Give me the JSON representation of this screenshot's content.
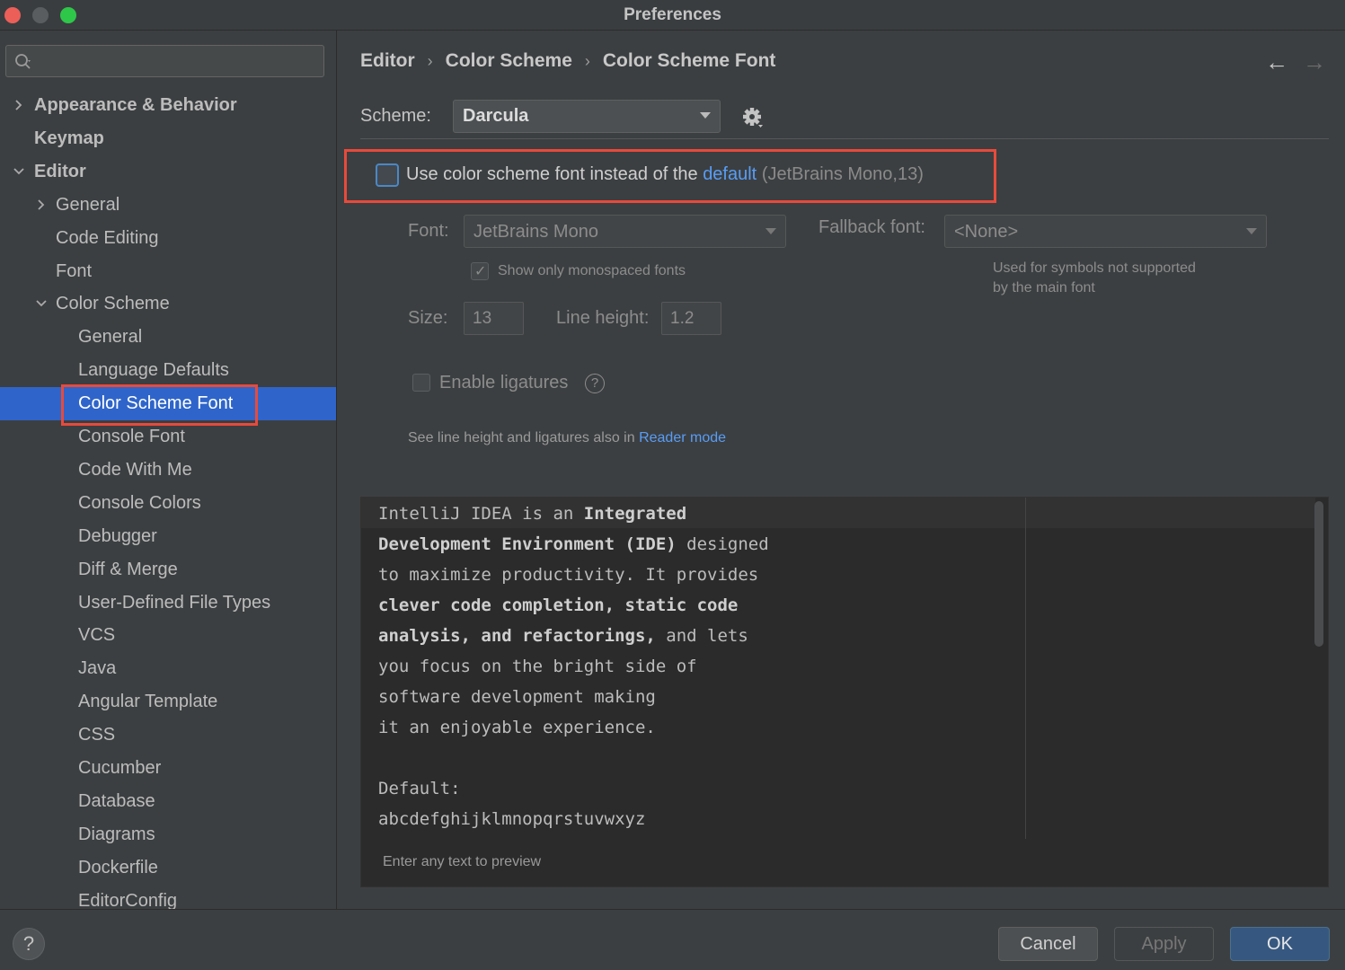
{
  "window": {
    "title": "Preferences"
  },
  "search": {
    "placeholder": "",
    "value": ""
  },
  "sidebar": {
    "items": [
      {
        "label": "Appearance & Behavior",
        "level": 0,
        "chevron": ">",
        "bold": true
      },
      {
        "label": "Keymap",
        "level": 0,
        "chevron": "",
        "bold": true
      },
      {
        "label": "Editor",
        "level": 0,
        "chevron": "v",
        "bold": true
      },
      {
        "label": "General",
        "level": 1,
        "chevron": ">"
      },
      {
        "label": "Code Editing",
        "level": 1,
        "chevron": ""
      },
      {
        "label": "Font",
        "level": 1,
        "chevron": ""
      },
      {
        "label": "Color Scheme",
        "level": 1,
        "chevron": "v"
      },
      {
        "label": "General",
        "level": 2,
        "chevron": ""
      },
      {
        "label": "Language Defaults",
        "level": 2,
        "chevron": ""
      },
      {
        "label": "Color Scheme Font",
        "level": 2,
        "chevron": "",
        "selected": true
      },
      {
        "label": "Console Font",
        "level": 2,
        "chevron": ""
      },
      {
        "label": "Code With Me",
        "level": 2,
        "chevron": ""
      },
      {
        "label": "Console Colors",
        "level": 2,
        "chevron": ""
      },
      {
        "label": "Debugger",
        "level": 2,
        "chevron": ""
      },
      {
        "label": "Diff & Merge",
        "level": 2,
        "chevron": ""
      },
      {
        "label": "User-Defined File Types",
        "level": 2,
        "chevron": ""
      },
      {
        "label": "VCS",
        "level": 2,
        "chevron": ""
      },
      {
        "label": "Java",
        "level": 2,
        "chevron": ""
      },
      {
        "label": "Angular Template",
        "level": 2,
        "chevron": ""
      },
      {
        "label": "CSS",
        "level": 2,
        "chevron": ""
      },
      {
        "label": "Cucumber",
        "level": 2,
        "chevron": ""
      },
      {
        "label": "Database",
        "level": 2,
        "chevron": ""
      },
      {
        "label": "Diagrams",
        "level": 2,
        "chevron": ""
      },
      {
        "label": "Dockerfile",
        "level": 2,
        "chevron": ""
      },
      {
        "label": "EditorConfig",
        "level": 2,
        "chevron": ""
      }
    ]
  },
  "breadcrumb": {
    "items": [
      "Editor",
      "Color Scheme",
      "Color Scheme Font"
    ],
    "separator": "›",
    "back": "←",
    "forward": "→"
  },
  "scheme": {
    "label": "Scheme:",
    "value": "Darcula"
  },
  "use_font": {
    "checked": false,
    "text": "Use color scheme font instead of the",
    "link": "default",
    "hint": "(JetBrains Mono,13)"
  },
  "font": {
    "label": "Font:",
    "value": "JetBrains Mono"
  },
  "fallback": {
    "label": "Fallback font:",
    "value": "<None>",
    "hint_line1": "Used for symbols not supported",
    "hint_line2": "by the main font"
  },
  "monospaced": {
    "label": "Show only monospaced fonts",
    "checked": true,
    "check_glyph": "✓"
  },
  "size": {
    "label": "Size:",
    "value": "13"
  },
  "line_height": {
    "label": "Line height:",
    "value": "1.2"
  },
  "ligatures": {
    "label": "Enable ligatures",
    "checked": false,
    "help": "?"
  },
  "see_also": {
    "text": "See line height and ligatures also in",
    "link": "Reader mode"
  },
  "preview": {
    "lines": [
      [
        {
          "t": "IntelliJ IDEA is an ",
          "b": false
        },
        {
          "t": "Integrated",
          "b": true
        }
      ],
      [
        {
          "t": "Development Environment (IDE)",
          "b": true
        },
        {
          "t": " designed",
          "b": false
        }
      ],
      [
        {
          "t": "to maximize productivity. It provides",
          "b": false
        }
      ],
      [
        {
          "t": "clever code completion, static code",
          "b": true
        }
      ],
      [
        {
          "t": "analysis, and refactorings,",
          "b": true
        },
        {
          "t": " and lets",
          "b": false
        }
      ],
      [
        {
          "t": "you focus on the bright side of",
          "b": false
        }
      ],
      [
        {
          "t": "software development making",
          "b": false
        }
      ],
      [
        {
          "t": "it an enjoyable experience.",
          "b": false
        }
      ],
      [
        {
          "t": "",
          "b": false
        }
      ],
      [
        {
          "t": "Default:",
          "b": false
        }
      ],
      [
        {
          "t": "abcdefghijklmnopqrstuvwxyz",
          "b": false
        }
      ]
    ],
    "hint": "Enter any text to preview"
  },
  "footer": {
    "help": "?",
    "cancel": "Cancel",
    "apply": "Apply",
    "ok": "OK"
  },
  "colors": {
    "accent": "#2f65ca",
    "link": "#589df6",
    "highlight_box": "#e84a3c"
  }
}
